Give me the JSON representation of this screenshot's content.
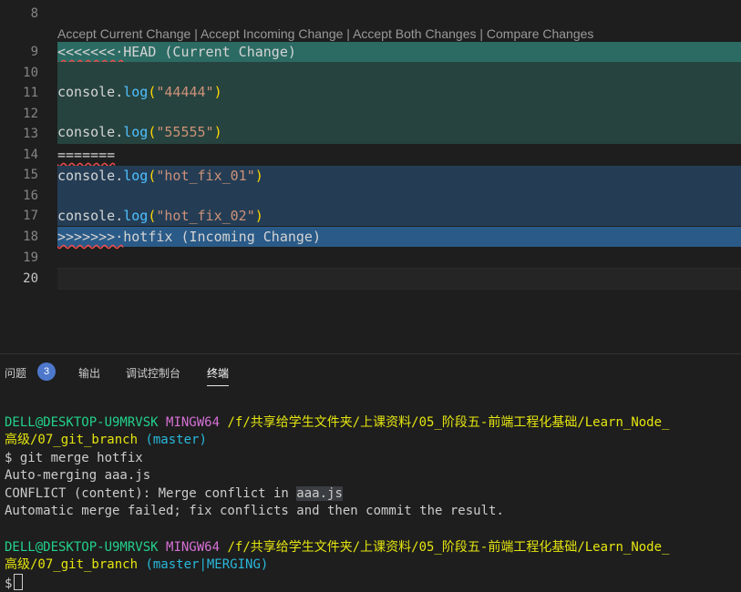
{
  "editor": {
    "codelens": {
      "accept_current": "Accept Current Change",
      "accept_incoming": "Accept Incoming Change",
      "accept_both": "Accept Both Changes",
      "compare": "Compare Changes",
      "separator": " | "
    },
    "line_numbers": [
      "8",
      "9",
      "10",
      "11",
      "12",
      "13",
      "14",
      "15",
      "16",
      "17",
      "18",
      "19",
      "20"
    ],
    "lines": {
      "head_marker": "<<<<<<<·",
      "head_label": "HEAD (Current Change)",
      "c1_obj": "console.",
      "c1_fn": "log",
      "c1_str": "\"44444\"",
      "c2_obj": "console.",
      "c2_fn": "log",
      "c2_str": "\"55555\"",
      "sep_marker": "=======",
      "i1_obj": "console.",
      "i1_fn": "log",
      "i1_str": "\"hot_fix_01\"",
      "i2_obj": "console.",
      "i2_fn": "log",
      "i2_str": "\"hot_fix_02\"",
      "inc_marker": ">>>>>>>·",
      "inc_label": "hotfix (Incoming Change)",
      "open_paren": "(",
      "close_paren": ")"
    }
  },
  "panel": {
    "tabs": [
      {
        "label": "问题",
        "badge": "3"
      },
      {
        "label": "输出"
      },
      {
        "label": "调试控制台"
      },
      {
        "label": "终端"
      }
    ]
  },
  "terminal": {
    "prompt1": {
      "user": "DELL@DESKTOP-U9MRVSK",
      "env": "MINGW64",
      "path_a": "/f/共享给学生文件夹/上课资料/05_阶段五-前端工程化基础/Learn_Node_",
      "path_b": "高级/07_git_branch",
      "branch": "(master)"
    },
    "command": "$ git merge hotfix",
    "out1": "Auto-merging aaa.js",
    "out2_pre": "CONFLICT (content): Merge conflict in ",
    "out2_file": "aaa.js",
    "out3": "Automatic merge failed; fix conflicts and then commit the result.",
    "prompt2": {
      "user": "DELL@DESKTOP-U9MRVSK",
      "env": "MINGW64",
      "path_a": "/f/共享给学生文件夹/上课资料/05_阶段五-前端工程化基础/Learn_Node_",
      "path_b": "高级/07_git_branch",
      "branch": "(master|MERGING)"
    },
    "prompt_symbol": "$"
  },
  "colors": {
    "current_header": "#2b6b63",
    "current_body": "#27433f",
    "incoming_body": "#243d55",
    "incoming_header": "#2a5a87",
    "badge": "#4d78cc"
  }
}
